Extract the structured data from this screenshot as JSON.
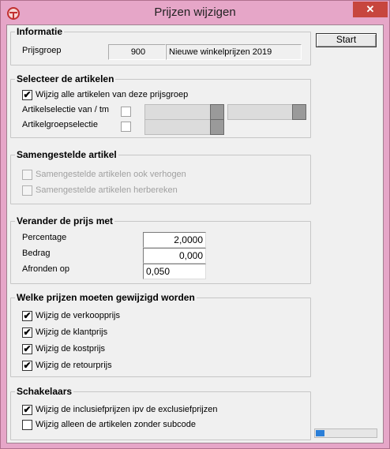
{
  "window": {
    "title": "Prijzen wijzigen",
    "close_label": "✕"
  },
  "start_button": "Start",
  "informatie": {
    "title": "Informatie",
    "prijsgroep_label": "Prijsgroep",
    "prijsgroep_code": "900",
    "prijsgroep_name": "Nieuwe winkelprijzen 2019"
  },
  "selecteer": {
    "title": "Selecteer de artikelen",
    "all_articles_label": "Wijzig alle artikelen van deze prijsgroep",
    "all_articles_checked": true,
    "selection_label": "Artikelselectie van / tm",
    "selection_checked": false,
    "group_label": "Artikelgroepselectie",
    "group_checked": false
  },
  "samengestelde": {
    "title": "Samengestelde artikel",
    "raise_label": "Samengestelde artikelen ook verhogen",
    "raise_checked": false,
    "recalc_label": "Samengestelde artikelen herbereken",
    "recalc_checked": false
  },
  "verander": {
    "title": "Verander de prijs met",
    "percentage_label": "Percentage",
    "percentage_value": "2,0000",
    "bedrag_label": "Bedrag",
    "bedrag_value": "0,000",
    "afronden_label": "Afronden op",
    "afronden_value": "0,050"
  },
  "welke": {
    "title": "Welke prijzen moeten gewijzigd worden",
    "items": [
      {
        "label": "Wijzig de verkoopprijs",
        "checked": true
      },
      {
        "label": "Wijzig de klantprijs",
        "checked": true
      },
      {
        "label": "Wijzig de kostprijs",
        "checked": true
      },
      {
        "label": "Wijzig de retourprijs",
        "checked": true
      }
    ]
  },
  "schakelaars": {
    "title": "Schakelaars",
    "inclusive_label": "Wijzig de inclusiefprijzen ipv de exclusiefprijzen",
    "inclusive_checked": true,
    "no_subcode_label": "Wijzig alleen de artikelen zonder subcode",
    "no_subcode_checked": false
  },
  "progress": {
    "fraction": 0.15
  },
  "colors": {
    "title_bar": "#e6a6c8",
    "close_button": "#c7463e",
    "progress_fill": "#2b7fd8"
  }
}
